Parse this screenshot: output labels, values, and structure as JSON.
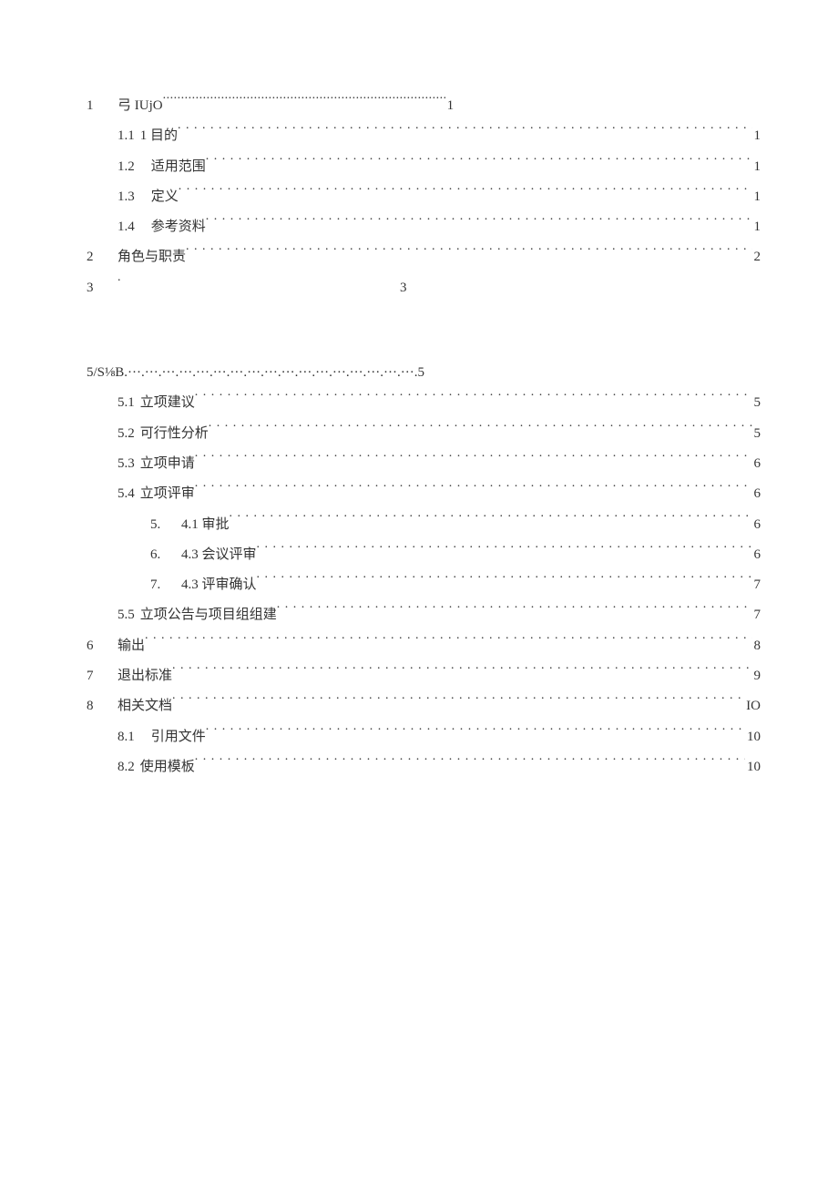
{
  "toc": [
    {
      "level": 0,
      "num": "1",
      "title": "弓 IUjO",
      "page": "1",
      "leader": "dense",
      "inline_page": false
    },
    {
      "level": 1,
      "num": "1.1",
      "numspacing": "narrow",
      "title": "1 目的",
      "page": "1"
    },
    {
      "level": 1,
      "num": "1.2",
      "numspacing": "wide",
      "title": "适用范围",
      "page": "1"
    },
    {
      "level": 1,
      "num": "1.3",
      "numspacing": "wide",
      "title": "定义",
      "page": "1"
    },
    {
      "level": 1,
      "num": "1.4",
      "numspacing": "wide",
      "title": "参考资料",
      "page": "1"
    },
    {
      "level": 0,
      "num": "2",
      "title": "角色与职责",
      "page": "2"
    },
    {
      "level": 0,
      "num": "3",
      "title": "",
      "page": "3",
      "leader": "stars",
      "inline_page": true
    },
    {
      "sep": true
    },
    {
      "level": 0,
      "num": "",
      "title": "5/S⅛B.···.···.···.···.···.···.···.···.···.···.···.···.···.···.···.···.···.5",
      "page": "",
      "raw": true
    },
    {
      "level": 1,
      "num": "5.1",
      "title": "立项建议",
      "page": "5"
    },
    {
      "level": 1,
      "num": "5.2",
      "title": "可行性分析",
      "page": "5"
    },
    {
      "level": 1,
      "num": "5.3",
      "title": "立项申请",
      "page": "6"
    },
    {
      "level": 1,
      "num": "5.4",
      "title": "立项评审",
      "page": "6"
    },
    {
      "level": 2,
      "num": "5.",
      "title": "4.1 审批",
      "page": "6"
    },
    {
      "level": 2,
      "num": "6.",
      "title": "4.3 会议评审",
      "page": "6"
    },
    {
      "level": 2,
      "num": "7.",
      "title": "4.3 评审确认",
      "page": "7"
    },
    {
      "level": 1,
      "num": "5.5",
      "title": "立项公告与项目组组建",
      "page": "7"
    },
    {
      "level": 0,
      "num": "6",
      "title": "输出",
      "page": "8"
    },
    {
      "level": 0,
      "num": "7",
      "title": "退出标准",
      "page": "9"
    },
    {
      "level": 0,
      "num": "8",
      "title": "相关文档",
      "page": "IO"
    },
    {
      "level": 1,
      "num": "8.1",
      "numspacing": "wide",
      "title": "引用文件",
      "page": "10"
    },
    {
      "level": 1,
      "num": "8.2",
      "title": "使用模板",
      "page": "10"
    }
  ]
}
